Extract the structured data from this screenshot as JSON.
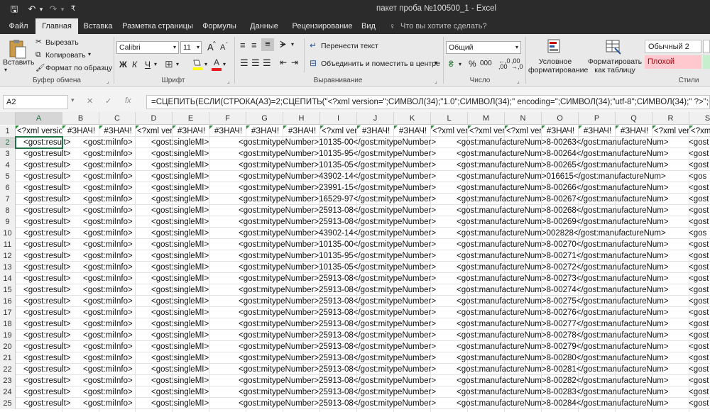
{
  "window": {
    "title": "пакет проба №100500_1  -  Excel",
    "qat": {
      "save": "🖫",
      "undo": "↶",
      "undo_drop": "▾",
      "redo": "↷",
      "redo_drop": "▾",
      "customize": "₹"
    }
  },
  "tabs": [
    {
      "label": "Файл"
    },
    {
      "label": "Главная"
    },
    {
      "label": "Вставка"
    },
    {
      "label": "Разметка страницы"
    },
    {
      "label": "Формулы"
    },
    {
      "label": "Данные"
    },
    {
      "label": "Рецензирование"
    },
    {
      "label": "Вид"
    }
  ],
  "tell_me": {
    "icon": "♀",
    "placeholder": "Что вы хотите сделать?"
  },
  "ribbon": {
    "clipboard": {
      "paste": "Вставить",
      "cut": "Вырезать",
      "copy": "Копировать",
      "format_painter": "Формат по образцу",
      "group": "Буфер обмена"
    },
    "font": {
      "name": "Calibri",
      "size": "11",
      "grow": "A",
      "shrink": "A",
      "bold": "Ж",
      "italic": "К",
      "underline": "Ч",
      "group": "Шрифт"
    },
    "alignment": {
      "wrap": "Перенести текст",
      "merge": "Объединить и поместить в центре",
      "group": "Выравнивание"
    },
    "number": {
      "format": "Общий",
      "percent": "%",
      "comma": "000",
      "group": "Число"
    },
    "styles": {
      "conditional": "Условное форматирование",
      "format_table": "Форматировать как таблицу",
      "normal2": "Обычный 2",
      "bad": "Плохой",
      "group": "Стили"
    }
  },
  "formula_bar": {
    "name_box": "A2",
    "cancel": "✕",
    "enter": "✓",
    "fx": "fx",
    "formula": "=СЦЕПИТЬ(ЕСЛИ(СТРОКА(A3)=2;СЦЕПИТЬ(\"<?xml version=\";СИМВОЛ(34);\"1.0\";СИМВОЛ(34);\" encoding=\";СИМВОЛ(34);\"utf-8\";СИМВОЛ(34);\" ?>\";СИМВОЛ("
  },
  "columns": [
    "A",
    "B",
    "C",
    "D",
    "E",
    "F",
    "G",
    "H",
    "I",
    "J",
    "K",
    "L",
    "M",
    "N",
    "O",
    "P",
    "Q",
    "R",
    "S"
  ],
  "row1": [
    "<?xml versio",
    "#ЗНАЧ!",
    "#ЗНАЧ!",
    "<?xml ver",
    "#ЗНАЧ!",
    "#ЗНАЧ!",
    "#ЗНАЧ!",
    "#ЗНАЧ!",
    "<?xml ver",
    "#ЗНАЧ!",
    "#ЗНАЧ!",
    "<?xml ver",
    "<?xml ver",
    "<?xml ver",
    "#ЗНАЧ!",
    "#ЗНАЧ!",
    "#ЗНАЧ!",
    "<?xml ver",
    "<?xml ver"
  ],
  "rows": [
    {
      "n": "2",
      "a": "<gost:result>",
      "b": "<gost:miInfo>",
      "d": "<gost:singleMI>",
      "h": "<gost:mitypeNumber>10135-00</gost:mitypeNumber>",
      "m": "<gost:manufactureNum>8-00263</gost:manufactureNum>",
      "s": "<gost"
    },
    {
      "n": "3",
      "a": "<gost:result>",
      "b": "<gost:miInfo>",
      "d": "<gost:singleMI>",
      "h": "<gost:mitypeNumber>10135-95</gost:mitypeNumber>",
      "m": "<gost:manufactureNum>8-00264</gost:manufactureNum>",
      "s": "<gost"
    },
    {
      "n": "4",
      "a": "<gost:result>",
      "b": "<gost:miInfo>",
      "d": "<gost:singleMI>",
      "h": "<gost:mitypeNumber>10135-05</gost:mitypeNumber>",
      "m": "<gost:manufactureNum>8-00265</gost:manufactureNum>",
      "s": "<gost"
    },
    {
      "n": "5",
      "a": "<gost:result>",
      "b": "<gost:miInfo>",
      "d": "<gost:singleMI>",
      "h": "<gost:mitypeNumber>43902-14</gost:mitypeNumber>",
      "m": "<gost:manufactureNum>016615</gost:manufactureNum>",
      "s": "<gos"
    },
    {
      "n": "6",
      "a": "<gost:result>",
      "b": "<gost:miInfo>",
      "d": "<gost:singleMI>",
      "h": "<gost:mitypeNumber>23991-15</gost:mitypeNumber>",
      "m": "<gost:manufactureNum>8-00266</gost:manufactureNum>",
      "s": "<gost"
    },
    {
      "n": "7",
      "a": "<gost:result>",
      "b": "<gost:miInfo>",
      "d": "<gost:singleMI>",
      "h": "<gost:mitypeNumber>16529-97</gost:mitypeNumber>",
      "m": "<gost:manufactureNum>8-00267</gost:manufactureNum>",
      "s": "<gost"
    },
    {
      "n": "8",
      "a": "<gost:result>",
      "b": "<gost:miInfo>",
      "d": "<gost:singleMI>",
      "h": "<gost:mitypeNumber>25913-08</gost:mitypeNumber>",
      "m": "<gost:manufactureNum>8-00268</gost:manufactureNum>",
      "s": "<gost"
    },
    {
      "n": "9",
      "a": "<gost:result>",
      "b": "<gost:miInfo>",
      "d": "<gost:singleMI>",
      "h": "<gost:mitypeNumber>25913-08</gost:mitypeNumber>",
      "m": "<gost:manufactureNum>8-00269</gost:manufactureNum>",
      "s": "<gost"
    },
    {
      "n": "10",
      "a": "<gost:result>",
      "b": "<gost:miInfo>",
      "d": "<gost:singleMI>",
      "h": "<gost:mitypeNumber>43902-14</gost:mitypeNumber>",
      "m": "<gost:manufactureNum>002828</gost:manufactureNum>",
      "s": "<gos"
    },
    {
      "n": "11",
      "a": "<gost:result>",
      "b": "<gost:miInfo>",
      "d": "<gost:singleMI>",
      "h": "<gost:mitypeNumber>10135-00</gost:mitypeNumber>",
      "m": "<gost:manufactureNum>8-00270</gost:manufactureNum>",
      "s": "<gost"
    },
    {
      "n": "12",
      "a": "<gost:result>",
      "b": "<gost:miInfo>",
      "d": "<gost:singleMI>",
      "h": "<gost:mitypeNumber>10135-95</gost:mitypeNumber>",
      "m": "<gost:manufactureNum>8-00271</gost:manufactureNum>",
      "s": "<gost"
    },
    {
      "n": "13",
      "a": "<gost:result>",
      "b": "<gost:miInfo>",
      "d": "<gost:singleMI>",
      "h": "<gost:mitypeNumber>10135-05</gost:mitypeNumber>",
      "m": "<gost:manufactureNum>8-00272</gost:manufactureNum>",
      "s": "<gost"
    },
    {
      "n": "14",
      "a": "<gost:result>",
      "b": "<gost:miInfo>",
      "d": "<gost:singleMI>",
      "h": "<gost:mitypeNumber>25913-08</gost:mitypeNumber>",
      "m": "<gost:manufactureNum>8-00273</gost:manufactureNum>",
      "s": "<gost"
    },
    {
      "n": "15",
      "a": "<gost:result>",
      "b": "<gost:miInfo>",
      "d": "<gost:singleMI>",
      "h": "<gost:mitypeNumber>25913-08</gost:mitypeNumber>",
      "m": "<gost:manufactureNum>8-00274</gost:manufactureNum>",
      "s": "<gost"
    },
    {
      "n": "16",
      "a": "<gost:result>",
      "b": "<gost:miInfo>",
      "d": "<gost:singleMI>",
      "h": "<gost:mitypeNumber>25913-08</gost:mitypeNumber>",
      "m": "<gost:manufactureNum>8-00275</gost:manufactureNum>",
      "s": "<gost"
    },
    {
      "n": "17",
      "a": "<gost:result>",
      "b": "<gost:miInfo>",
      "d": "<gost:singleMI>",
      "h": "<gost:mitypeNumber>25913-08</gost:mitypeNumber>",
      "m": "<gost:manufactureNum>8-00276</gost:manufactureNum>",
      "s": "<gost"
    },
    {
      "n": "18",
      "a": "<gost:result>",
      "b": "<gost:miInfo>",
      "d": "<gost:singleMI>",
      "h": "<gost:mitypeNumber>25913-08</gost:mitypeNumber>",
      "m": "<gost:manufactureNum>8-00277</gost:manufactureNum>",
      "s": "<gost"
    },
    {
      "n": "19",
      "a": "<gost:result>",
      "b": "<gost:miInfo>",
      "d": "<gost:singleMI>",
      "h": "<gost:mitypeNumber>25913-08</gost:mitypeNumber>",
      "m": "<gost:manufactureNum>8-00278</gost:manufactureNum>",
      "s": "<gost"
    },
    {
      "n": "20",
      "a": "<gost:result>",
      "b": "<gost:miInfo>",
      "d": "<gost:singleMI>",
      "h": "<gost:mitypeNumber>25913-08</gost:mitypeNumber>",
      "m": "<gost:manufactureNum>8-00279</gost:manufactureNum>",
      "s": "<gost"
    },
    {
      "n": "21",
      "a": "<gost:result>",
      "b": "<gost:miInfo>",
      "d": "<gost:singleMI>",
      "h": "<gost:mitypeNumber>25913-08</gost:mitypeNumber>",
      "m": "<gost:manufactureNum>8-00280</gost:manufactureNum>",
      "s": "<gost"
    },
    {
      "n": "22",
      "a": "<gost:result>",
      "b": "<gost:miInfo>",
      "d": "<gost:singleMI>",
      "h": "<gost:mitypeNumber>25913-08</gost:mitypeNumber>",
      "m": "<gost:manufactureNum>8-00281</gost:manufactureNum>",
      "s": "<gost"
    },
    {
      "n": "23",
      "a": "<gost:result>",
      "b": "<gost:miInfo>",
      "d": "<gost:singleMI>",
      "h": "<gost:mitypeNumber>25913-08</gost:mitypeNumber>",
      "m": "<gost:manufactureNum>8-00282</gost:manufactureNum>",
      "s": "<gost"
    },
    {
      "n": "24",
      "a": "<gost:result>",
      "b": "<gost:miInfo>",
      "d": "<gost:singleMI>",
      "h": "<gost:mitypeNumber>25913-08</gost:mitypeNumber>",
      "m": "<gost:manufactureNum>8-00283</gost:manufactureNum>",
      "s": "<gost"
    },
    {
      "n": "25",
      "a": "<gost:result>",
      "b": "<gost:miInfo>",
      "d": "<gost:singleMI>",
      "h": "<gost:mitypeNumber>25913-08</gost:mitypeNumber>",
      "m": "<gost:manufactureNum>8-00284</gost:manufactureNum>",
      "s": "<gost"
    }
  ],
  "colors": {
    "accent": "#217346",
    "error_triangle": "#2f8f3d",
    "bad_fill": "#ffc7ce",
    "bad_text": "#9c0006"
  }
}
